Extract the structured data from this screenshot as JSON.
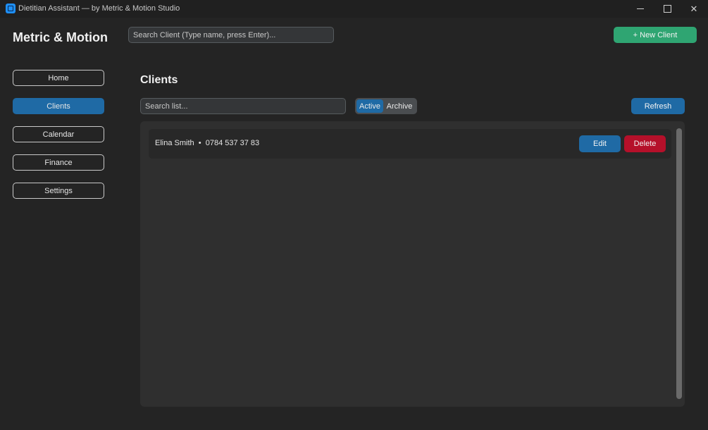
{
  "window": {
    "title": "Dietitian Assistant — by Metric & Motion Studio",
    "icon": "app-icon",
    "controls": {
      "minimize": "minimize-icon",
      "maximize": "maximize-icon",
      "close": "✕"
    }
  },
  "header": {
    "logo": "Metric & Motion",
    "search_placeholder": "Search Client (Type name, press Enter)...",
    "new_client_label": "+ New Client"
  },
  "sidebar": {
    "items": [
      {
        "label": "Home",
        "active": false
      },
      {
        "label": "Clients",
        "active": true
      },
      {
        "label": "Calendar",
        "active": false
      },
      {
        "label": "Finance",
        "active": false
      },
      {
        "label": "Settings",
        "active": false
      }
    ]
  },
  "main": {
    "title": "Clients",
    "list_search_placeholder": "Search list...",
    "filter": {
      "options": [
        "Active",
        "Archive"
      ],
      "selected": "Active"
    },
    "refresh_label": "Refresh",
    "clients": [
      {
        "summary": "Elina Smith  •  0784 537 37 83",
        "edit_label": "Edit",
        "delete_label": "Delete"
      }
    ]
  },
  "colors": {
    "background": "#242424",
    "accent": "#1f6aa5",
    "success": "#2fa572",
    "danger": "#b5102a"
  }
}
